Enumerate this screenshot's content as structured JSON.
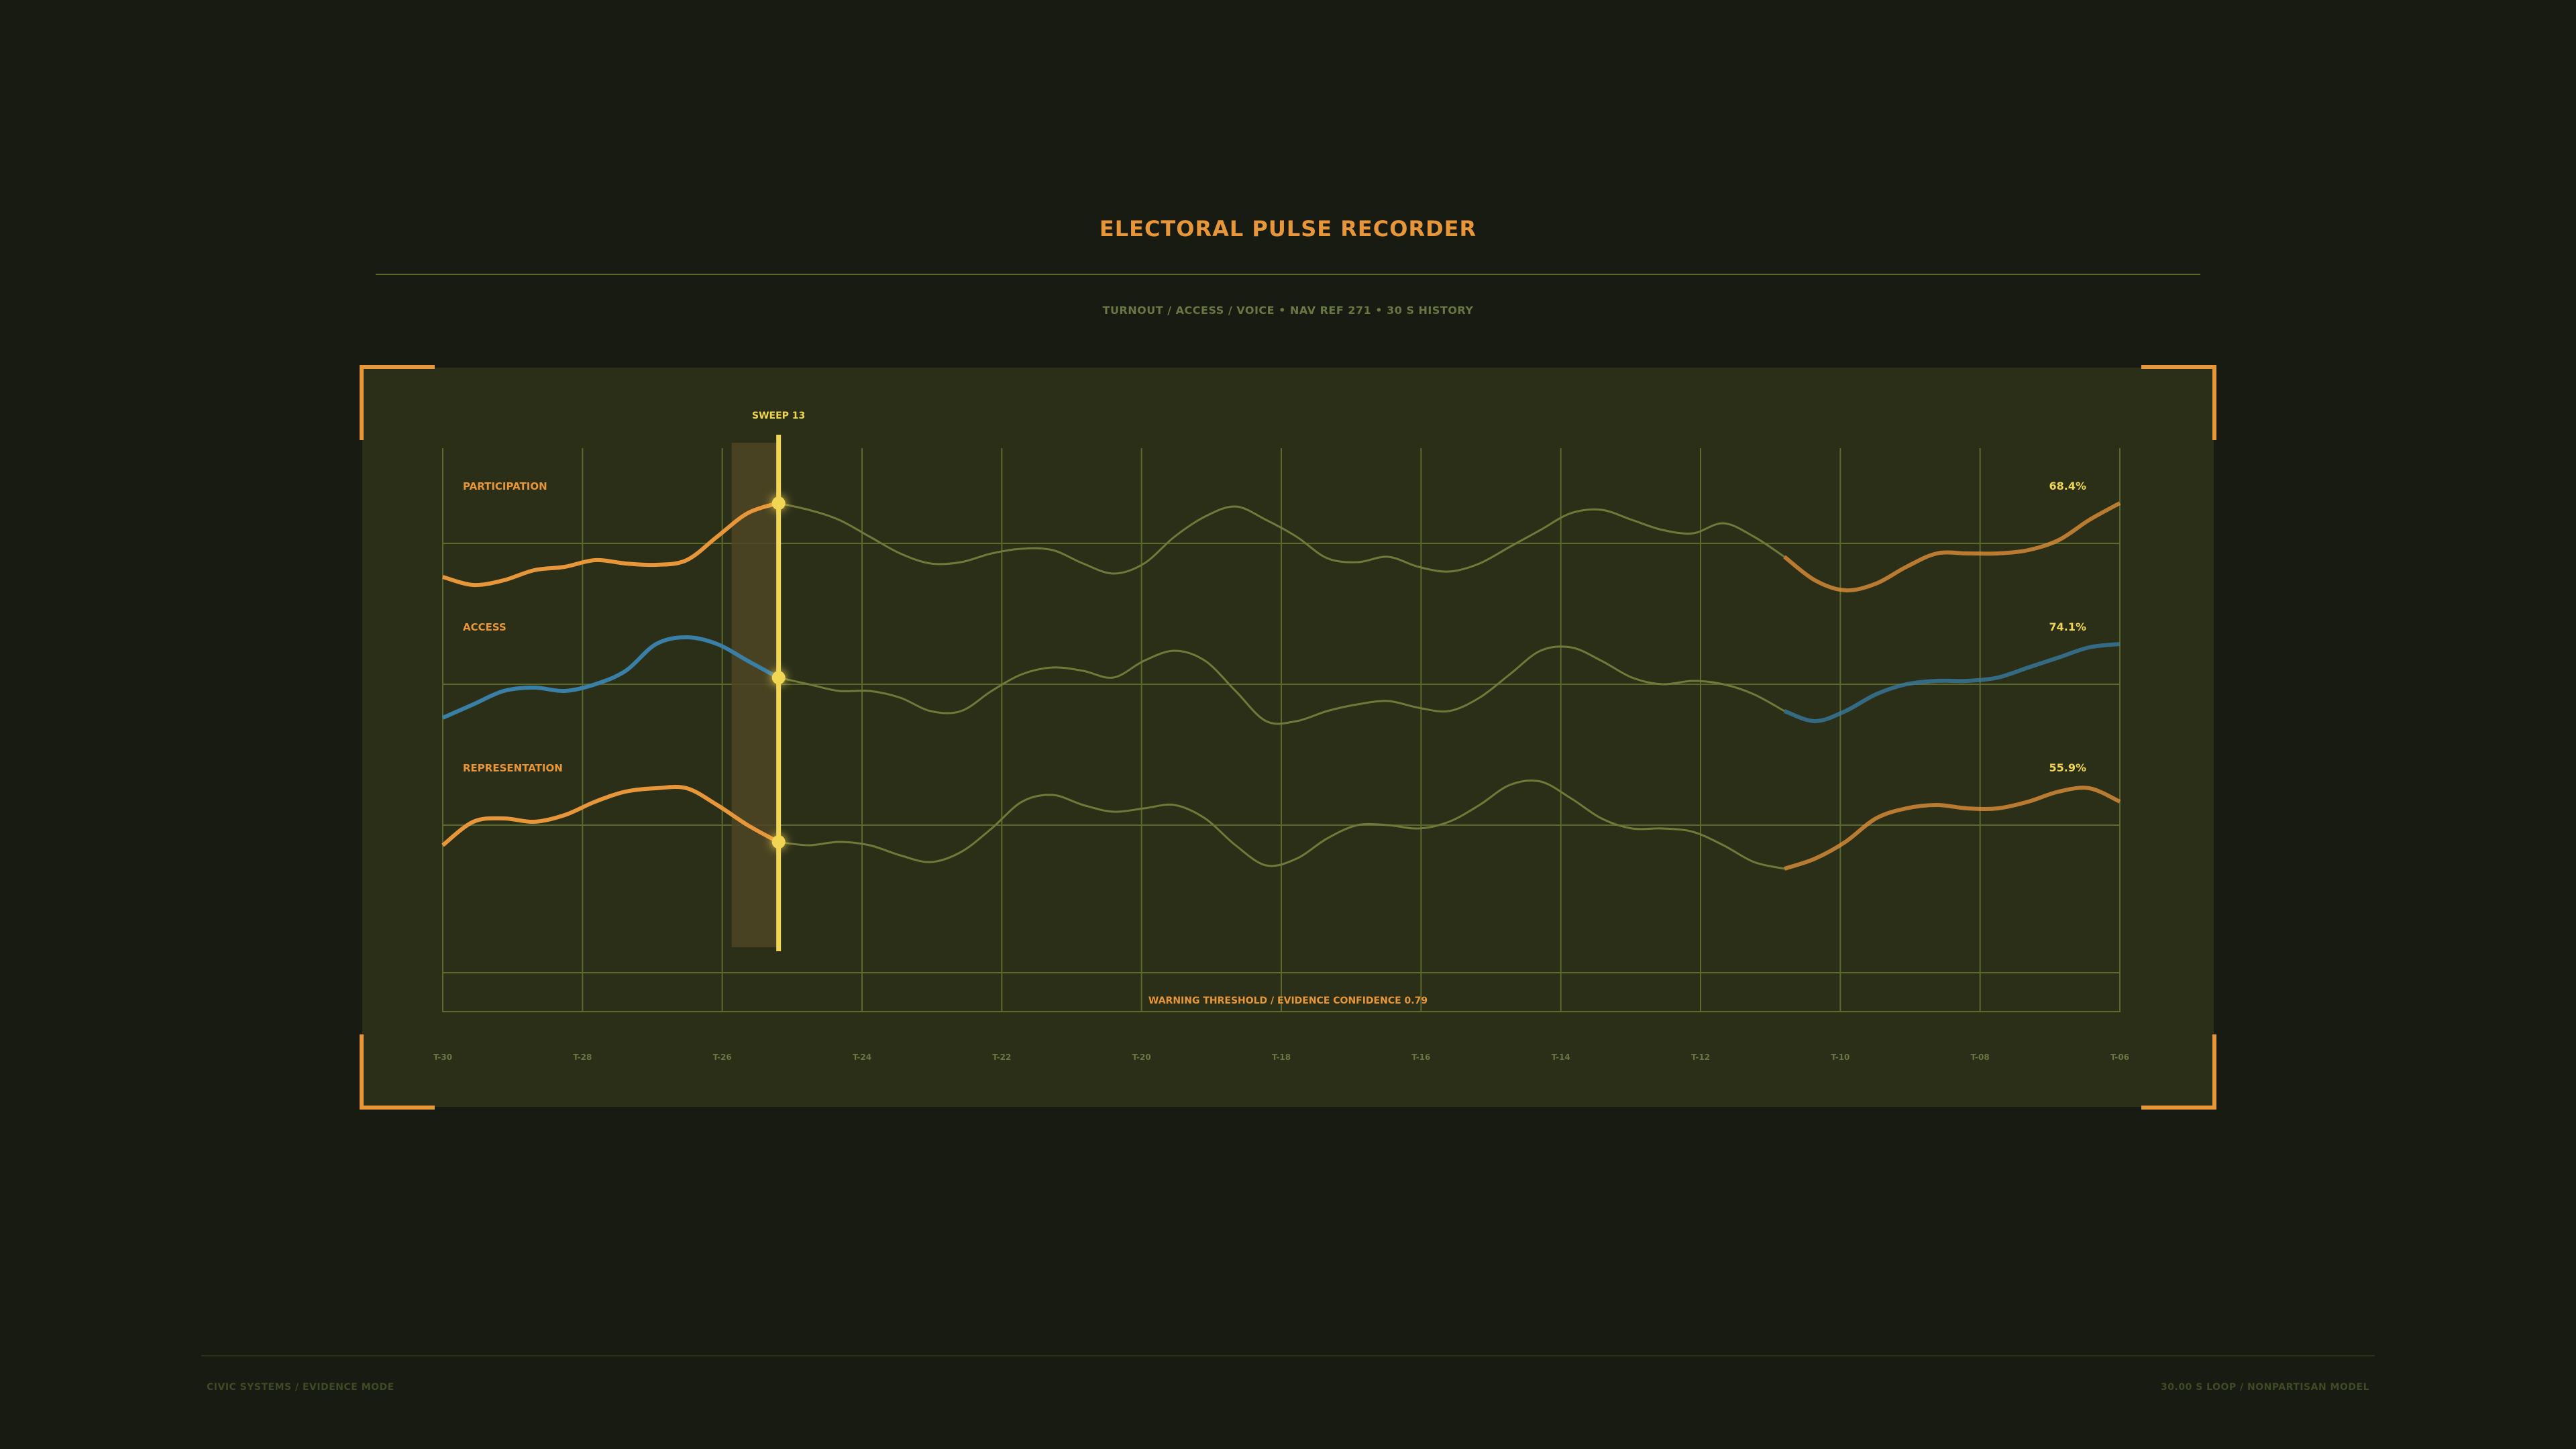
{
  "header": {
    "title": "ELECTORAL PULSE RECORDER",
    "subtitle": "TURNOUT / ACCESS / VOICE  •  NAV REF 271  •  30 S HISTORY"
  },
  "scope": {
    "sweep_label": "SWEEP 13",
    "threshold_label": "WARNING THRESHOLD / EVIDENCE CONFIDENCE 0.79"
  },
  "footer": {
    "left": "CIVIC SYSTEMS / EVIDENCE MODE",
    "right": "30.00 S LOOP / NONPARTISAN MODEL"
  },
  "colors": {
    "accent": "#e8963a",
    "sweep": "#f0d653",
    "access": "#3a7fa8",
    "grid": "#5b6a2c",
    "panel": "#2b2f18",
    "background": "#171b12"
  },
  "chart_data": {
    "type": "line",
    "x_ticks": [
      "T-30",
      "T-28",
      "T-26",
      "T-24",
      "T-22",
      "T-20",
      "T-18",
      "T-16",
      "T-14",
      "T-12",
      "T-10",
      "T-08",
      "T-06"
    ],
    "sweep_position": "T-26",
    "series": [
      {
        "name": "PARTICIPATION",
        "readout": "68.4%",
        "color": "#e8963a",
        "values": [
          -0.5,
          -0.62,
          -0.55,
          -0.4,
          -0.35,
          -0.25,
          -0.3,
          -0.32,
          -0.25,
          0.1,
          0.45,
          0.6,
          0.5,
          0.35,
          0.1,
          -0.15,
          -0.3,
          -0.28,
          -0.15,
          -0.08,
          -0.1,
          -0.3,
          -0.45,
          -0.3,
          0.1,
          0.4,
          0.55,
          0.35,
          0.1,
          -0.22,
          -0.28,
          -0.2,
          -0.35,
          -0.42,
          -0.3,
          -0.05,
          0.2,
          0.45,
          0.5,
          0.35,
          0.2,
          0.15,
          0.3,
          0.1,
          -0.2,
          -0.55,
          -0.7,
          -0.6,
          -0.35,
          -0.15,
          -0.15,
          -0.15,
          -0.1,
          0.05,
          0.35,
          0.6
        ]
      },
      {
        "name": "ACCESS",
        "readout": "74.1%",
        "color": "#3a7fa8",
        "values": [
          -0.5,
          -0.3,
          -0.1,
          -0.05,
          -0.1,
          0.0,
          0.2,
          0.6,
          0.7,
          0.6,
          0.35,
          0.1,
          0.0,
          -0.1,
          -0.1,
          -0.2,
          -0.4,
          -0.4,
          -0.1,
          0.15,
          0.25,
          0.2,
          0.1,
          0.35,
          0.5,
          0.35,
          -0.1,
          -0.55,
          -0.55,
          -0.4,
          -0.3,
          -0.25,
          -0.35,
          -0.4,
          -0.2,
          0.15,
          0.5,
          0.55,
          0.35,
          0.1,
          0.0,
          0.05,
          0.0,
          -0.15,
          -0.4,
          -0.55,
          -0.4,
          -0.15,
          0.0,
          0.05,
          0.05,
          0.1,
          0.25,
          0.4,
          0.55,
          0.6
        ]
      },
      {
        "name": "REPRESENTATION",
        "readout": "55.9%",
        "color": "#e8963a",
        "values": [
          -0.3,
          0.05,
          0.1,
          0.05,
          0.15,
          0.35,
          0.5,
          0.55,
          0.55,
          0.3,
          0.0,
          -0.25,
          -0.3,
          -0.25,
          -0.3,
          -0.45,
          -0.55,
          -0.4,
          -0.05,
          0.35,
          0.45,
          0.3,
          0.2,
          0.25,
          0.3,
          0.1,
          -0.3,
          -0.6,
          -0.5,
          -0.2,
          0.0,
          0.0,
          -0.05,
          0.05,
          0.3,
          0.6,
          0.65,
          0.4,
          0.1,
          -0.05,
          -0.05,
          -0.1,
          -0.3,
          -0.55,
          -0.65,
          -0.5,
          -0.25,
          0.1,
          0.25,
          0.3,
          0.25,
          0.25,
          0.35,
          0.5,
          0.55,
          0.35
        ]
      }
    ]
  }
}
